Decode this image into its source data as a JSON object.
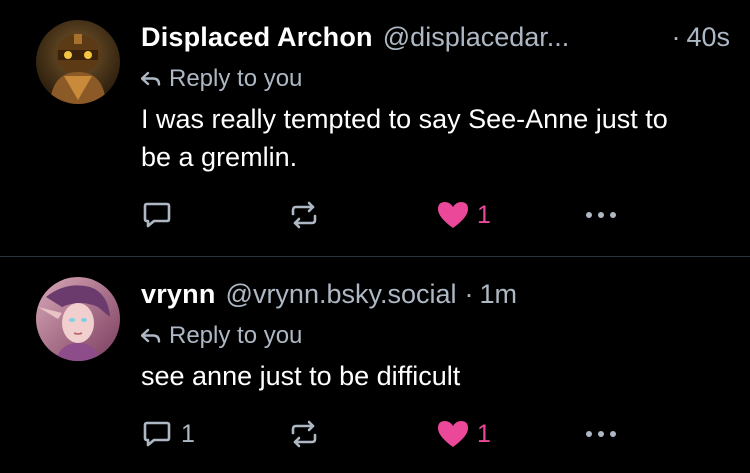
{
  "colors": {
    "background": "#000000",
    "text": "#ffffff",
    "muted": "#aeb8c4",
    "like": "#ec4899",
    "divider": "#2b3440"
  },
  "posts": [
    {
      "author_name": "Displaced Archon",
      "handle": "@displacedar...",
      "time": "40s",
      "reply_label": "Reply to you",
      "text": "I was really tempted to say See-Anne just to  be a gremlin.",
      "reply_count": "",
      "like_count": "1",
      "liked": true,
      "avatar_icon": "armored-helmet-avatar"
    },
    {
      "author_name": "vrynn",
      "handle": "@vrynn.bsky.social",
      "time": "1m",
      "reply_label": "Reply to you",
      "text": "see anne just to be difficult",
      "reply_count": "1",
      "like_count": "1",
      "liked": true,
      "avatar_icon": "elf-character-avatar"
    }
  ],
  "icons": {
    "reply": "reply-arrow-icon",
    "comment": "comment-icon",
    "repost": "repost-icon",
    "like": "heart-icon",
    "more": "more-options-icon"
  }
}
